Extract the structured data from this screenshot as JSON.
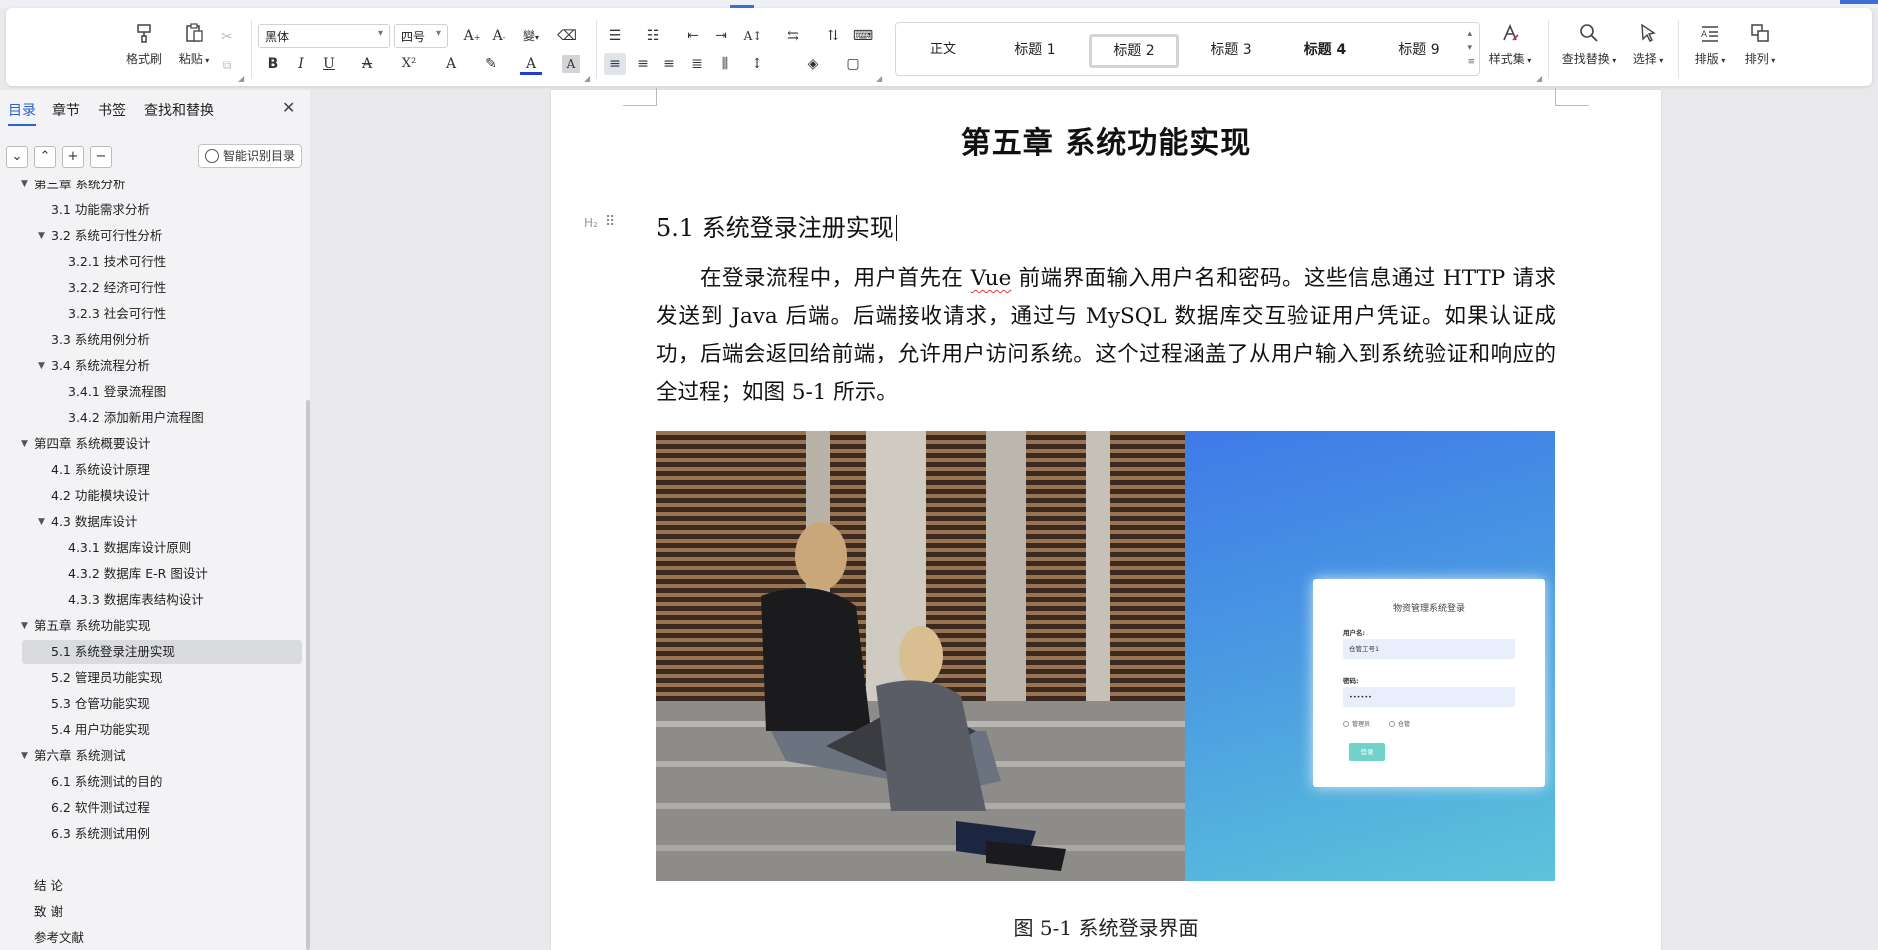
{
  "ribbon": {
    "format_painter": "格式刷",
    "paste": "粘贴",
    "font_name": "黑体",
    "font_size": "四号",
    "styles": [
      "正文",
      "标题 1",
      "标题 2",
      "标题 3",
      "标题 4",
      "标题 9"
    ],
    "style_set": "样式集",
    "find_replace": "查找替换",
    "select": "选择",
    "layout": "排版",
    "arrange": "排列",
    "format_buttons": {
      "bold": "B",
      "italic": "I",
      "underline": "U",
      "strike": "A",
      "superscript": "X²",
      "font_color": "A",
      "shade": "A"
    }
  },
  "nav": {
    "tabs": [
      "目录",
      "章节",
      "书签",
      "查找和替换"
    ],
    "smart_toc": "智能识别目录",
    "items": [
      {
        "label": "第三章  系统分析",
        "level": 0,
        "expanded": true
      },
      {
        "label": "3.1 功能需求分析",
        "level": 1
      },
      {
        "label": "3.2 系统可行性分析",
        "level": 1,
        "expanded": true
      },
      {
        "label": "3.2.1 技术可行性",
        "level": 2
      },
      {
        "label": "3.2.2  经济可行性",
        "level": 2
      },
      {
        "label": "3.2.3 社会可行性",
        "level": 2
      },
      {
        "label": "3.3  系统用例分析",
        "level": 1
      },
      {
        "label": "3.4 系统流程分析",
        "level": 1,
        "expanded": true
      },
      {
        "label": "3.4.1  登录流程图",
        "level": 2
      },
      {
        "label": "3.4.2  添加新用户流程图",
        "level": 2
      },
      {
        "label": "第四章  系统概要设计",
        "level": 0,
        "expanded": true
      },
      {
        "label": "4.1 系统设计原理",
        "level": 1
      },
      {
        "label": "4.2 功能模块设计",
        "level": 1
      },
      {
        "label": "4.3  数据库设计",
        "level": 1,
        "expanded": true
      },
      {
        "label": "4.3.1 数据库设计原则",
        "level": 2
      },
      {
        "label": "4.3.2 数据库 E-R 图设计",
        "level": 2
      },
      {
        "label": "4.3.3 数据库表结构设计",
        "level": 2
      },
      {
        "label": "第五章  系统功能实现",
        "level": 0,
        "expanded": true
      },
      {
        "label": "5.1 系统登录注册实现",
        "level": 1,
        "selected": true
      },
      {
        "label": "5.2 管理员功能实现",
        "level": 1
      },
      {
        "label": "5.3 仓管功能实现",
        "level": 1
      },
      {
        "label": "5.4 用户功能实现",
        "level": 1
      },
      {
        "label": "第六章  系统测试",
        "level": 0,
        "expanded": true
      },
      {
        "label": "6.1 系统测试的目的",
        "level": 1
      },
      {
        "label": "6.2 软件测试过程",
        "level": 1
      },
      {
        "label": "6.3 系统测试用例",
        "level": 1
      },
      {
        "label": "",
        "level": 0
      },
      {
        "label": "结    论",
        "level": 0
      },
      {
        "label": "致  谢",
        "level": 0
      },
      {
        "label": "参考文献",
        "level": 0
      }
    ]
  },
  "document": {
    "chapter_title": "第五章  系统功能实现",
    "heading_marker": "H₂",
    "heading": "5.1 系统登录注册实现",
    "paragraph_lines": [
      "在登录流程中，用户首先在 Vue 前端界面输入用户名和密码。这些信息通过 HTTP 请求",
      "发送到 Java 后端。后端接收请求，通过与 MySQL 数据库交互验证用户凭证。如果认证成功，",
      "后端会返回给前端，允许用户访问系统。这个过程涵盖了从用户输入到系统验证和响应的全",
      "过程；如图 5-1 所示。"
    ],
    "figure_login": {
      "title": "物资管理系统登录",
      "username_label": "用户名:",
      "username_value": "仓管工号1",
      "password_label": "密码:",
      "password_value": "••••••",
      "radio_1": "管理员",
      "radio_2": "仓管",
      "login_button": "登录"
    },
    "caption": "图 5-1 系统登录界面"
  },
  "colors": {
    "accent": "#2a62d4",
    "spellcheck": "#e03a3a",
    "login_button": "#6fd3ca"
  }
}
